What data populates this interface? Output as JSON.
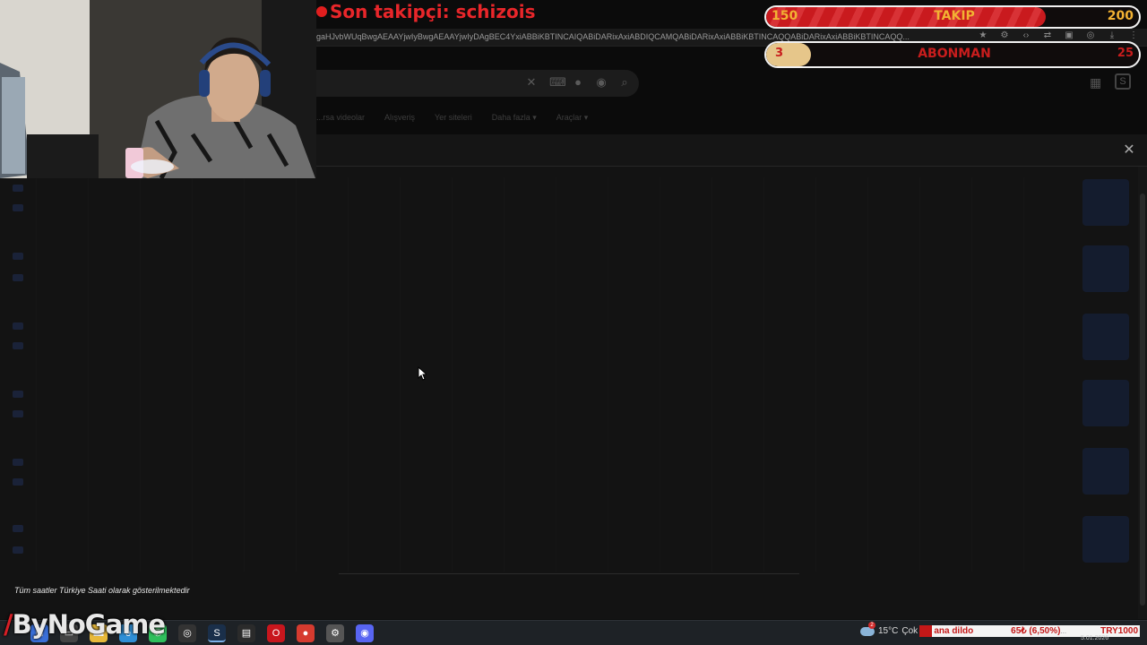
{
  "stream_overlay": {
    "last_follower": "Son takipçi: schizois",
    "follow_goal": {
      "label": "TAKIP",
      "current": "150",
      "target": "200",
      "progress": 0.75
    },
    "sub_goal": {
      "label": "ABONMAN",
      "current": "3",
      "target": "25",
      "progress": 0.12
    },
    "sponsor": "ByNoGame",
    "colors": {
      "accent_red": "#d61f26",
      "goal_gold": "#f2b233"
    }
  },
  "browser": {
    "url": "gaHJvbWUqBwgAEAAYjwIyBwgAEAAYjwIyDAgBEC4YxiABBiKBTINCAIQABiDARixAxiABDIQCAMQABiDARixAxiABBiKBTINCAQQABiDARixAxiABBiKBTINCAQQ...",
    "toolbar_icons": [
      "star-icon",
      "extension-icon",
      "code-icon",
      "translate-icon",
      "sidebar-icon",
      "profile-icon",
      "download-icon",
      "menu-icon"
    ],
    "search_icons": [
      "clear-icon",
      "keyboard-icon",
      "mic-icon",
      "lens-icon",
      "search-icon"
    ],
    "filters": [
      "...rsa videolar",
      "Alışveriş",
      "Yer siteleri",
      "Daha fazla ▾",
      "Araçlar ▾"
    ]
  },
  "panel": {
    "close_label": "✕",
    "timezone_note": "Tüm saatler Türkiye Saati olarak gösterilmektedir"
  },
  "taskbar": {
    "apps": [
      "start",
      "taskview",
      "explorer",
      "edge",
      "whatsapp",
      "obs",
      "steam",
      "chrome",
      "store",
      "opera",
      "chrome-2",
      "gear",
      "discord"
    ],
    "weather": {
      "temp": "15°C",
      "desc": "Çok",
      "notif_count": "2"
    },
    "ticker": {
      "item1": "ana dildo",
      "item2": "65₺ (6,50%)",
      "item3": "...",
      "item4": "TRY1000"
    },
    "date": "5.01.2026"
  }
}
